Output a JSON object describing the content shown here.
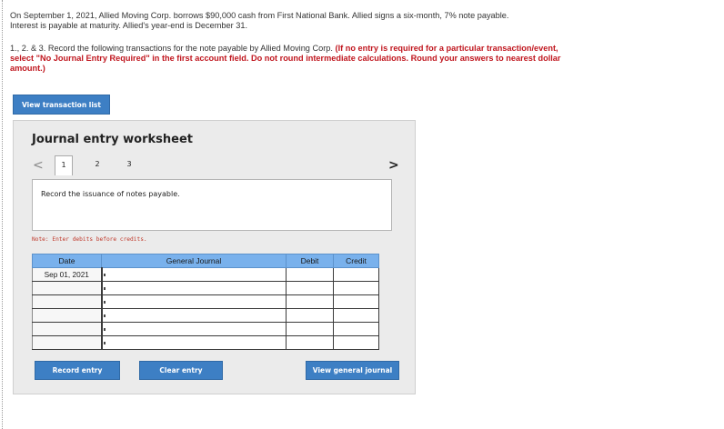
{
  "problem": {
    "line1": "On September 1, 2021, Allied Moving Corp. borrows $90,000 cash from First National Bank. Allied signs a six-month, 7% note payable.",
    "line2": "Interest is payable at maturity. Allied's year-end is December 31."
  },
  "instructions": {
    "prefix": "1., 2. & 3. Record the following transactions for the note payable by Allied Moving Corp.",
    "emphasis": "(If no entry is required for a particular transaction/event, select \"No Journal Entry Required\" in the first account field. Do not round intermediate calculations. Round your answers to nearest dollar amount.)"
  },
  "buttons": {
    "view_transaction_list": "View transaction list",
    "record_entry": "Record entry",
    "clear_entry": "Clear entry",
    "view_general_journal": "View general journal"
  },
  "worksheet": {
    "title": "Journal entry worksheet",
    "nav_prev": "<",
    "nav_next": ">",
    "tabs": [
      "1",
      "2",
      "3"
    ],
    "active_tab": "1",
    "description": "Record the issuance of notes payable.",
    "note": "Note: Enter debits before credits."
  },
  "journal": {
    "headers": {
      "date": "Date",
      "general_journal": "General Journal",
      "debit": "Debit",
      "credit": "Credit"
    },
    "first_date": "Sep 01, 2021",
    "blank_rows": 6
  },
  "colors": {
    "button_blue": "#3d7fc4",
    "header_blue": "#79b1ec",
    "instruction_red": "#c0161e"
  }
}
